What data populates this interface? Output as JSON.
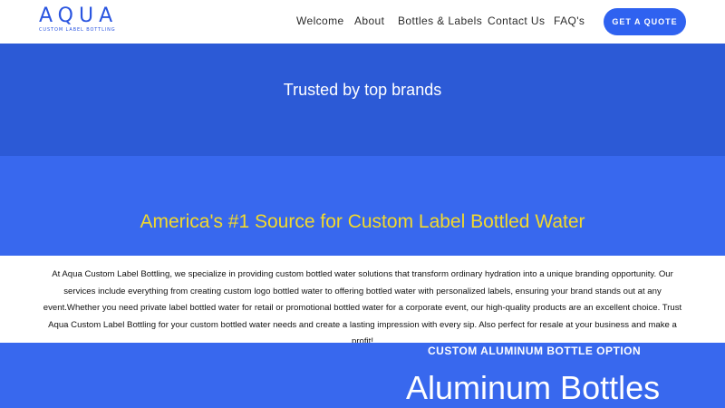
{
  "header": {
    "logo_word": "AQUA",
    "logo_tagline": "CUSTOM LABEL BOTTLING",
    "nav": [
      {
        "label": "Welcome"
      },
      {
        "label": "About"
      },
      {
        "label": "Bottles & Labels"
      },
      {
        "label": "Contact Us"
      },
      {
        "label": "FAQ's"
      }
    ],
    "cta_label": "GET A QUOTE"
  },
  "trusted": {
    "heading": "Trusted by top brands"
  },
  "hero": {
    "heading": "America's #1 Source for Custom Label Bottled Water"
  },
  "about": {
    "text": "At Aqua Custom Label Bottling, we specialize in providing custom bottled water solutions that transform ordinary hydration into a unique branding opportunity. Our services include everything from creating custom logo bottled water to offering bottled water with personalized labels, ensuring your brand stands out at any event.Whether you need private label bottled water for retail or promotional bottled water for a corporate event, our high-quality products are an excellent choice. Trust Aqua Custom Label Bottling for your custom bottled water needs and create a lasting impression with every sip. Also perfect for resale at your business and make a profit!"
  },
  "aluminum": {
    "eyebrow": "CUSTOM ALUMINUM BOTTLE OPTION",
    "heading": "Aluminum Bottles"
  },
  "colors": {
    "brand_blue": "#2a55e0",
    "trusted_band": "#2c5ad6",
    "hero_band": "#3868ee",
    "hero_heading": "#f2d92c",
    "cta": "#2f62f0"
  }
}
